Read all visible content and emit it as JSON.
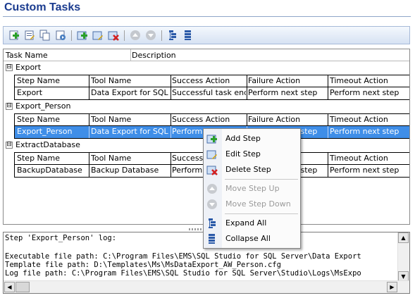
{
  "page": {
    "title": "Custom Tasks"
  },
  "toolbar": {
    "buttons": [
      {
        "name": "add-task-icon"
      },
      {
        "name": "edit-task-icon"
      },
      {
        "name": "copy-task-icon"
      },
      {
        "name": "run-task-icon"
      },
      {
        "name": "add-step-icon"
      },
      {
        "name": "edit-step-icon"
      },
      {
        "name": "delete-step-icon"
      },
      {
        "name": "move-up-icon"
      },
      {
        "name": "move-down-icon"
      },
      {
        "name": "expand-all-icon"
      },
      {
        "name": "collapse-all-icon"
      }
    ]
  },
  "grid": {
    "columns": [
      "Task Name",
      "Description"
    ],
    "sub_columns": [
      "Step Name",
      "Tool Name",
      "Success Action",
      "Failure Action",
      "Timeout Action"
    ],
    "groups": [
      {
        "name": "Export",
        "expander": "⊟",
        "row": [
          "Export",
          "Data Export for SQL Se",
          "Successful task endir",
          "Perform next step",
          "Perform next step"
        ],
        "selected": false
      },
      {
        "name": "Export_Person",
        "expander": "⊟",
        "row": [
          "Export_Person",
          "Data Export for SQL Se",
          "Perform n",
          "Perform next step",
          "Perform next step"
        ],
        "selected": true
      },
      {
        "name": "ExtractDatabase",
        "expander": "⊟",
        "row": [
          "BackupDatabase",
          "Backup Database",
          "Perform n",
          "Perform next step",
          "Perform next step"
        ],
        "selected": false
      }
    ]
  },
  "log": {
    "lines": [
      "Step 'Export_Person' log:",
      "",
      "Executable file path: C:\\Program Files\\EMS\\SQL Studio for SQL Server\\Data Export",
      "Template file path: D:\\Templates\\Ms\\MsDataExport_AW_Person.cfg",
      "Log file path: C:\\Program Files\\EMS\\SQL Studio for SQL Server\\Studio\\Logs\\MsExpo"
    ]
  },
  "context_menu": {
    "items": [
      {
        "label": "Add Step",
        "icon": "add-step-icon",
        "enabled": true
      },
      {
        "label": "Edit Step",
        "icon": "edit-step-icon",
        "enabled": true
      },
      {
        "label": "Delete Step",
        "icon": "delete-step-icon",
        "enabled": true
      },
      {
        "label": "Move Step Up",
        "icon": "move-up-icon",
        "enabled": false
      },
      {
        "label": "Move Step Down",
        "icon": "move-down-icon",
        "enabled": false
      },
      {
        "label": "Expand All",
        "icon": "expand-all-icon",
        "enabled": true
      },
      {
        "label": "Collapse All",
        "icon": "collapse-all-icon",
        "enabled": true
      }
    ]
  },
  "scroll": {
    "up": "▲",
    "down": "▼",
    "left": "◀",
    "right": "▶"
  },
  "colors": {
    "title": "#1a3b8f",
    "selection": "#3f8ee8",
    "toolbar": "#d6e2f3"
  }
}
